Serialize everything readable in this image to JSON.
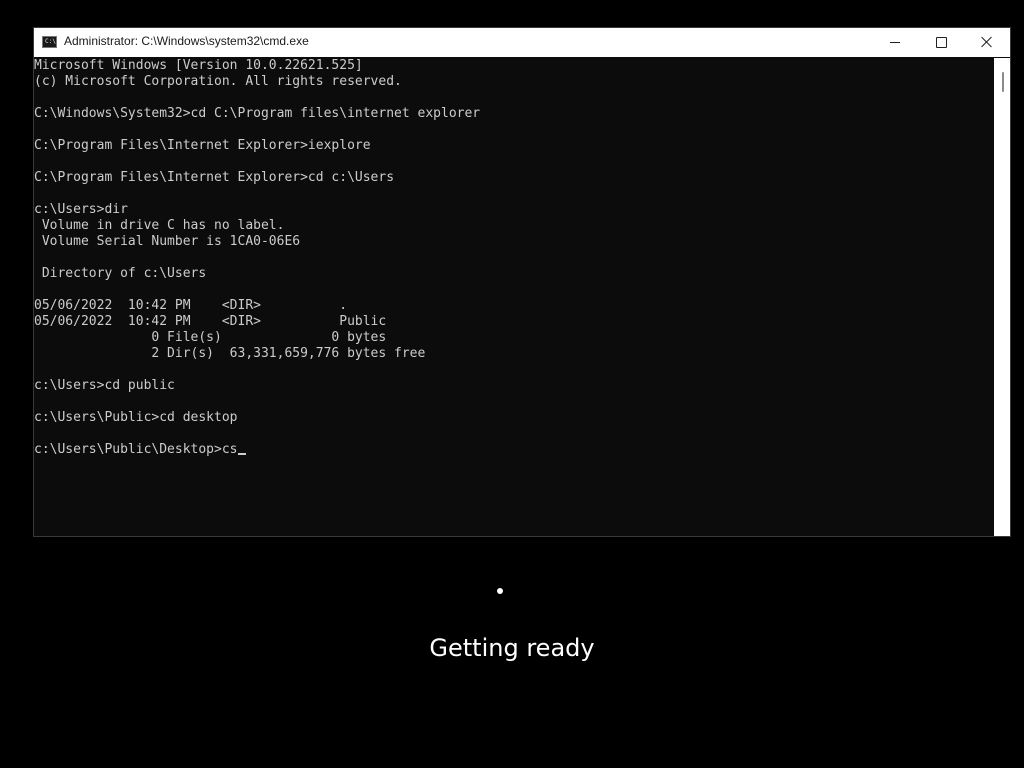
{
  "window": {
    "title": "Administrator: C:\\Windows\\system32\\cmd.exe",
    "icon": "cmd-icon"
  },
  "controls": {
    "minimize_icon": "minimize-icon",
    "maximize_icon": "maximize-icon",
    "close_icon": "close-icon"
  },
  "console": {
    "lines": [
      "Microsoft Windows [Version 10.0.22621.525]",
      "(c) Microsoft Corporation. All rights reserved.",
      "",
      "C:\\Windows\\System32>cd C:\\Program files\\internet explorer",
      "",
      "C:\\Program Files\\Internet Explorer>iexplore",
      "",
      "C:\\Program Files\\Internet Explorer>cd c:\\Users",
      "",
      "c:\\Users>dir",
      " Volume in drive C has no label.",
      " Volume Serial Number is 1CA0-06E6",
      "",
      " Directory of c:\\Users",
      "",
      "05/06/2022  10:42 PM    <DIR>          .",
      "05/06/2022  10:42 PM    <DIR>          Public",
      "               0 File(s)              0 bytes",
      "               2 Dir(s)  63,331,659,776 bytes free",
      "",
      "c:\\Users>cd public",
      "",
      "c:\\Users\\Public>cd desktop",
      ""
    ],
    "prompt_line": "c:\\Users\\Public\\Desktop>cs"
  },
  "status": {
    "text": "Getting ready"
  },
  "colors": {
    "console_bg": "#0c0c0c",
    "console_text": "#cccccc",
    "titlebar_bg": "#ffffff",
    "screen_bg": "#000000"
  }
}
